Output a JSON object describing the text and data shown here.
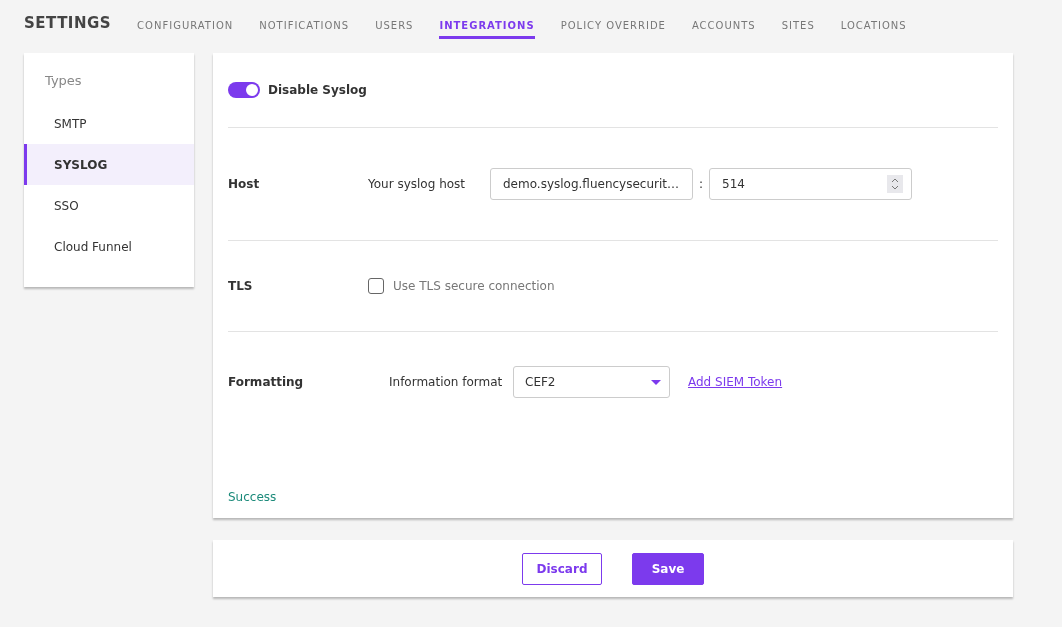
{
  "header": {
    "title": "SETTINGS"
  },
  "tabs": [
    {
      "label": "CONFIGURATION",
      "selected": false
    },
    {
      "label": "NOTIFICATIONS",
      "selected": false
    },
    {
      "label": "USERS",
      "selected": false
    },
    {
      "label": "INTEGRATIONS",
      "selected": true
    },
    {
      "label": "POLICY OVERRIDE",
      "selected": false
    },
    {
      "label": "ACCOUNTS",
      "selected": false
    },
    {
      "label": "SITES",
      "selected": false
    },
    {
      "label": "LOCATIONS",
      "selected": false
    }
  ],
  "sidebar": {
    "heading": "Types",
    "items": [
      {
        "label": "SMTP",
        "selected": false
      },
      {
        "label": "SYSLOG",
        "selected": true
      },
      {
        "label": "SSO",
        "selected": false
      },
      {
        "label": "Cloud Funnel",
        "selected": false
      }
    ]
  },
  "toggle": {
    "label": "Disable Syslog",
    "on": true
  },
  "host": {
    "title": "Host",
    "label": "Your syslog host",
    "value": "demo.syslog.fluencysecurit…",
    "separator": ":",
    "port": "514"
  },
  "tls": {
    "title": "TLS",
    "label": "Use TLS secure connection",
    "checked": false
  },
  "formatting": {
    "title": "Formatting",
    "label": "Information format",
    "value": "CEF2",
    "link": "Add SIEM Token"
  },
  "status": "Success",
  "buttons": {
    "discard": "Discard",
    "save": "Save"
  }
}
